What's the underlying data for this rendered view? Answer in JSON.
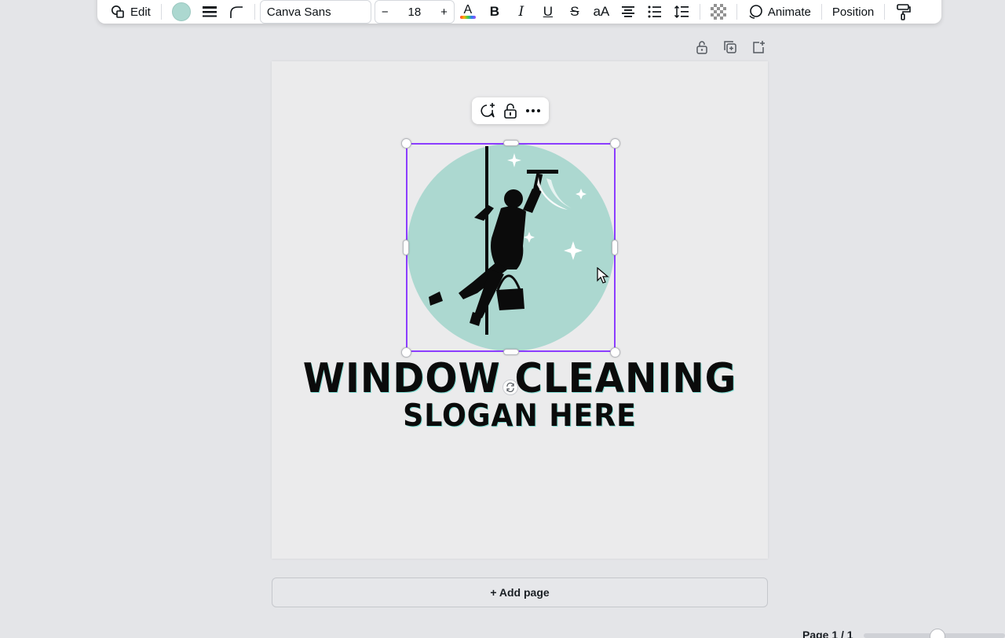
{
  "toolbar": {
    "edit_label": "Edit",
    "fill_color": "#acd8d0",
    "font_name": "Canva Sans",
    "font_size": "18",
    "decrease_label": "−",
    "increase_label": "+",
    "text_color_label": "A",
    "bold_label": "B",
    "italic_label": "I",
    "underline_label": "U",
    "strike_label": "S",
    "case_label": "aA",
    "animate_label": "Animate",
    "position_label": "Position"
  },
  "design": {
    "title": "WINDOW CLEANING",
    "slogan": "SLOGAN HERE",
    "circle_color": "#acd8d0",
    "selection_color": "#8b3dff"
  },
  "footer": {
    "add_page_label": "+ Add page",
    "page_indicator": "Page 1 / 1"
  }
}
